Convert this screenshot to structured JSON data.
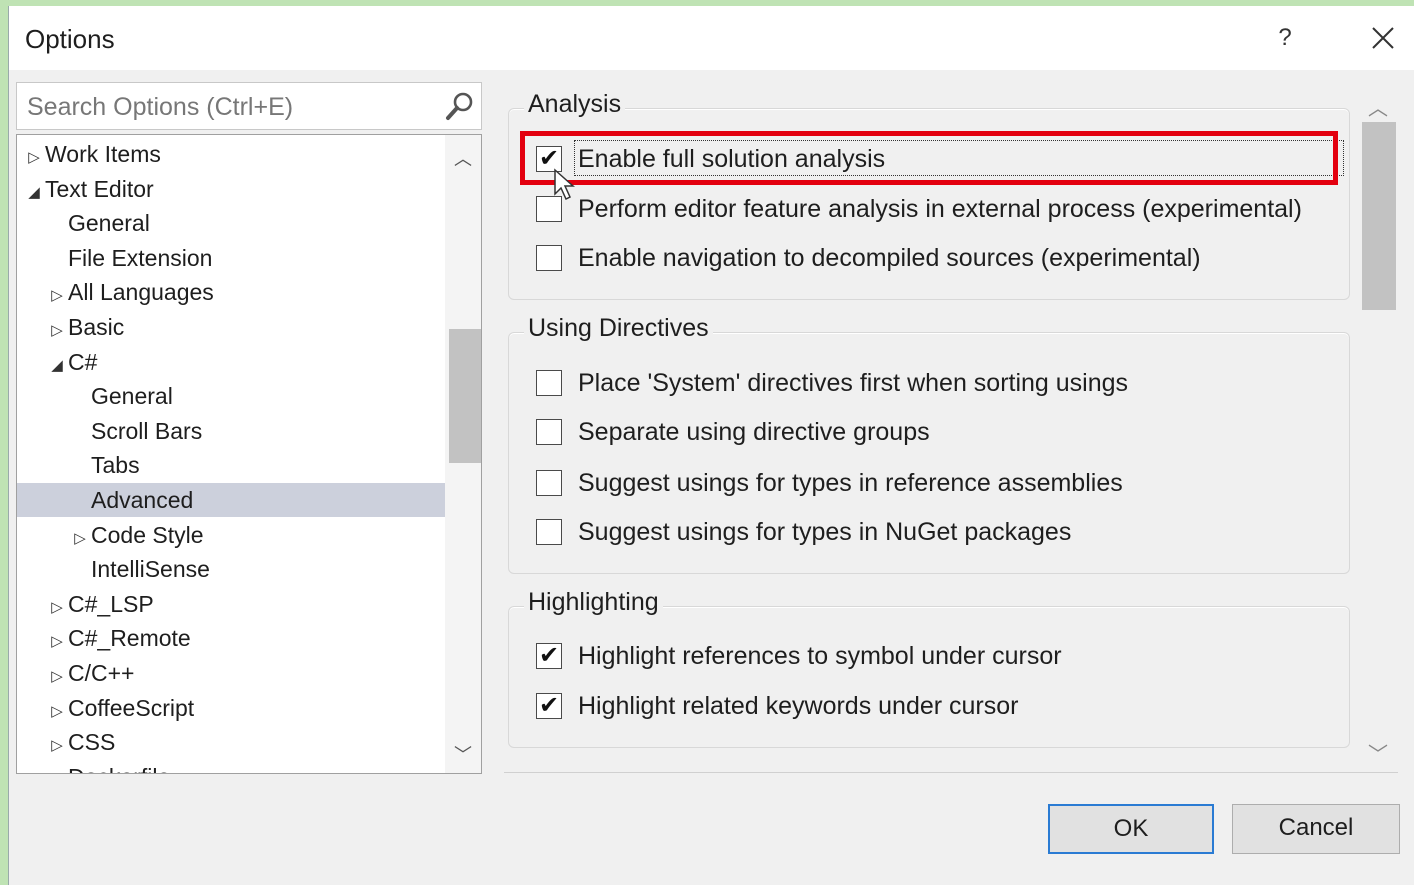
{
  "window": {
    "title": "Options",
    "help_label": "?",
    "close_label": "✕"
  },
  "search": {
    "placeholder": "Search Options (Ctrl+E)"
  },
  "tree": [
    {
      "label": "Work Items",
      "indent": 0,
      "toggle": "▷"
    },
    {
      "label": "Text Editor",
      "indent": 0,
      "toggle": "◢"
    },
    {
      "label": "General",
      "indent": 1,
      "toggle": ""
    },
    {
      "label": "File Extension",
      "indent": 1,
      "toggle": ""
    },
    {
      "label": "All Languages",
      "indent": 1,
      "toggle": "▷"
    },
    {
      "label": "Basic",
      "indent": 1,
      "toggle": "▷"
    },
    {
      "label": "C#",
      "indent": 1,
      "toggle": "◢"
    },
    {
      "label": "General",
      "indent": 2,
      "toggle": ""
    },
    {
      "label": "Scroll Bars",
      "indent": 2,
      "toggle": ""
    },
    {
      "label": "Tabs",
      "indent": 2,
      "toggle": ""
    },
    {
      "label": "Advanced",
      "indent": 2,
      "toggle": "",
      "selected": true
    },
    {
      "label": "Code Style",
      "indent": 2,
      "toggle": "▷"
    },
    {
      "label": "IntelliSense",
      "indent": 2,
      "toggle": ""
    },
    {
      "label": "C#_LSP",
      "indent": 1,
      "toggle": "▷"
    },
    {
      "label": "C#_Remote",
      "indent": 1,
      "toggle": "▷"
    },
    {
      "label": "C/C++",
      "indent": 1,
      "toggle": "▷"
    },
    {
      "label": "CoffeeScript",
      "indent": 1,
      "toggle": "▷"
    },
    {
      "label": "CSS",
      "indent": 1,
      "toggle": "▷"
    },
    {
      "label": "Dockerfile",
      "indent": 1,
      "toggle": "▷"
    }
  ],
  "groups": [
    {
      "title": "Analysis",
      "options": [
        {
          "label": "Enable full solution analysis",
          "checked": true
        },
        {
          "label": "Perform editor feature analysis in external process (experimental)",
          "checked": false
        },
        {
          "label": "Enable navigation to decompiled sources (experimental)",
          "checked": false
        }
      ]
    },
    {
      "title": "Using Directives",
      "options": [
        {
          "label": "Place 'System' directives first when sorting usings",
          "checked": false
        },
        {
          "label": "Separate using directive groups",
          "checked": false
        },
        {
          "label": "Suggest usings for types in reference assemblies",
          "checked": false
        },
        {
          "label": "Suggest usings for types in NuGet packages",
          "checked": false
        }
      ]
    },
    {
      "title": "Highlighting",
      "options": [
        {
          "label": "Highlight references to symbol under cursor",
          "checked": true
        },
        {
          "label": "Highlight related keywords under cursor",
          "checked": true
        }
      ]
    }
  ],
  "buttons": {
    "ok": "OK",
    "cancel": "Cancel"
  },
  "colors": {
    "accent": "#2a7bd3",
    "highlight_box": "#e3000f",
    "selected_row": "#ccd0dc"
  }
}
